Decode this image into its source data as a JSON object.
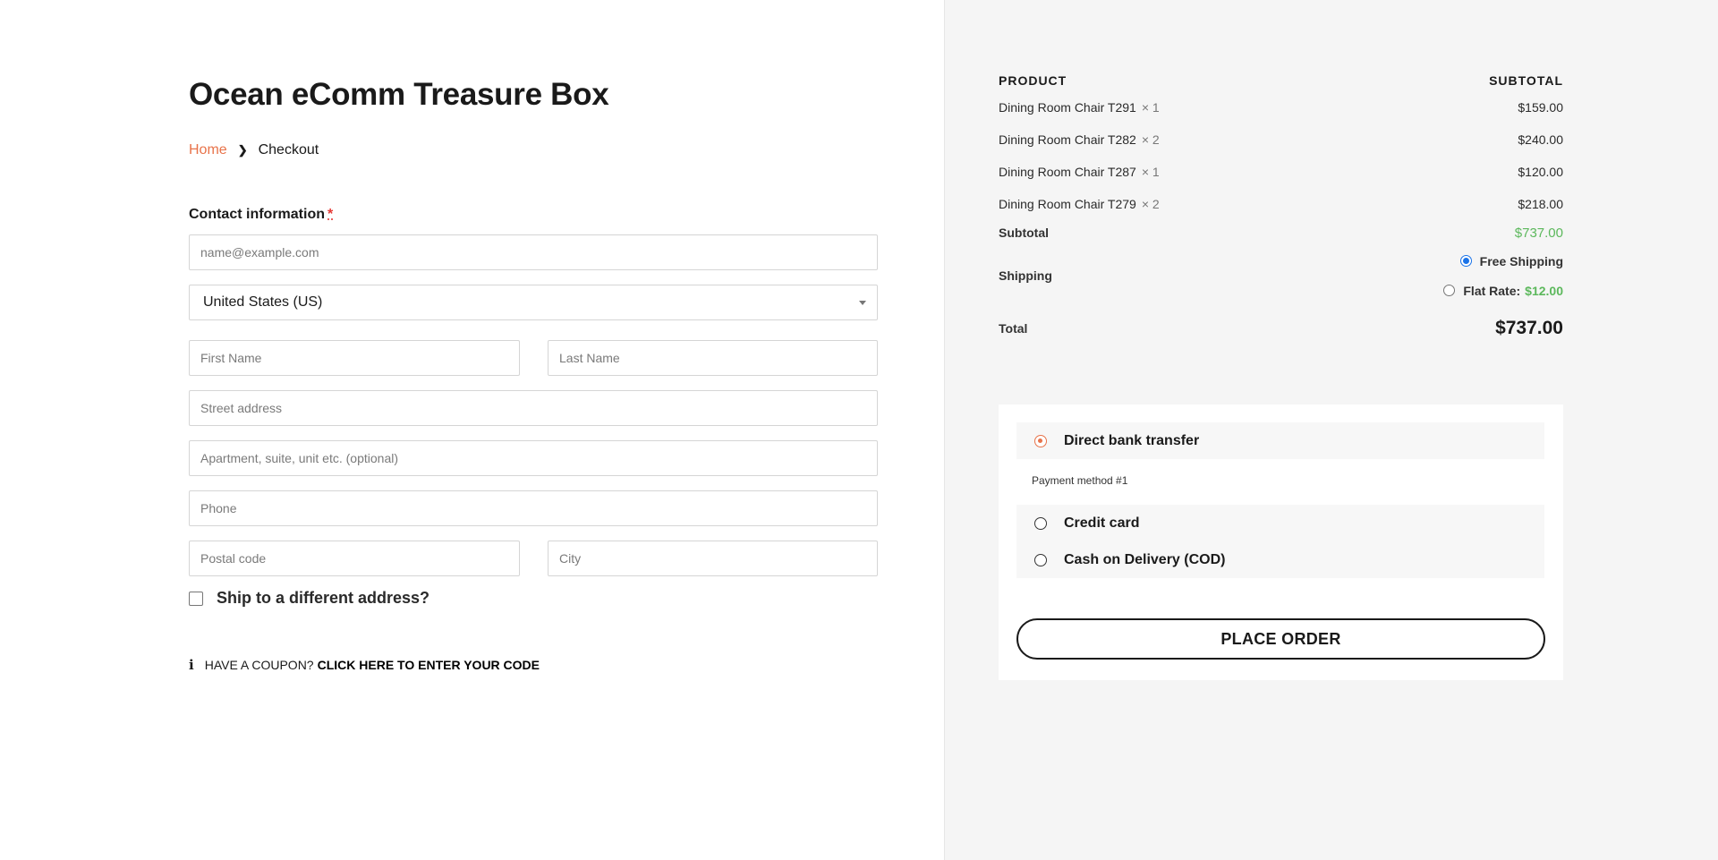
{
  "page": {
    "title": "Ocean eComm Treasure Box"
  },
  "breadcrumb": {
    "home": "Home",
    "current": "Checkout"
  },
  "contact": {
    "label": "Contact information",
    "required_mark": "*",
    "email_placeholder": "name@example.com"
  },
  "address": {
    "country_selected": "United States (US)",
    "first_name_placeholder": "First Name",
    "last_name_placeholder": "Last Name",
    "street_placeholder": "Street address",
    "apartment_placeholder": "Apartment, suite, unit etc. (optional)",
    "phone_placeholder": "Phone",
    "postal_placeholder": "Postal code",
    "city_placeholder": "City",
    "ship_different_label": "Ship to a different address?"
  },
  "coupon": {
    "icon": "info-icon",
    "prompt": "HAVE A COUPON?",
    "link": "CLICK HERE TO ENTER YOUR CODE"
  },
  "order_summary": {
    "product_header": "PRODUCT",
    "subtotal_header": "SUBTOTAL",
    "items": [
      {
        "name": "Dining Room Chair T291",
        "qty": "× 1",
        "price": "$159.00"
      },
      {
        "name": "Dining Room Chair T282",
        "qty": "× 2",
        "price": "$240.00"
      },
      {
        "name": "Dining Room Chair T287",
        "qty": "× 1",
        "price": "$120.00"
      },
      {
        "name": "Dining Room Chair T279",
        "qty": "× 2",
        "price": "$218.00"
      }
    ],
    "subtotal_label": "Subtotal",
    "subtotal_value": "$737.00",
    "shipping_label": "Shipping",
    "shipping_options": [
      {
        "label": "Free Shipping",
        "price": "",
        "selected": true
      },
      {
        "label": "Flat Rate:",
        "price": "$12.00",
        "selected": false
      }
    ],
    "total_label": "Total",
    "total_value": "$737.00"
  },
  "payment": {
    "methods": [
      {
        "label": "Direct bank transfer",
        "selected": true
      },
      {
        "label": "Credit card",
        "selected": false
      },
      {
        "label": "Cash on Delivery (COD)",
        "selected": false
      }
    ],
    "selected_description": "Payment method #1",
    "place_order_label": "PLACE ORDER"
  },
  "colors": {
    "accent": "#e8734a",
    "price_green": "#5cb85c",
    "radio_blue": "#1a73e8",
    "panel_bg": "#f5f5f5"
  }
}
